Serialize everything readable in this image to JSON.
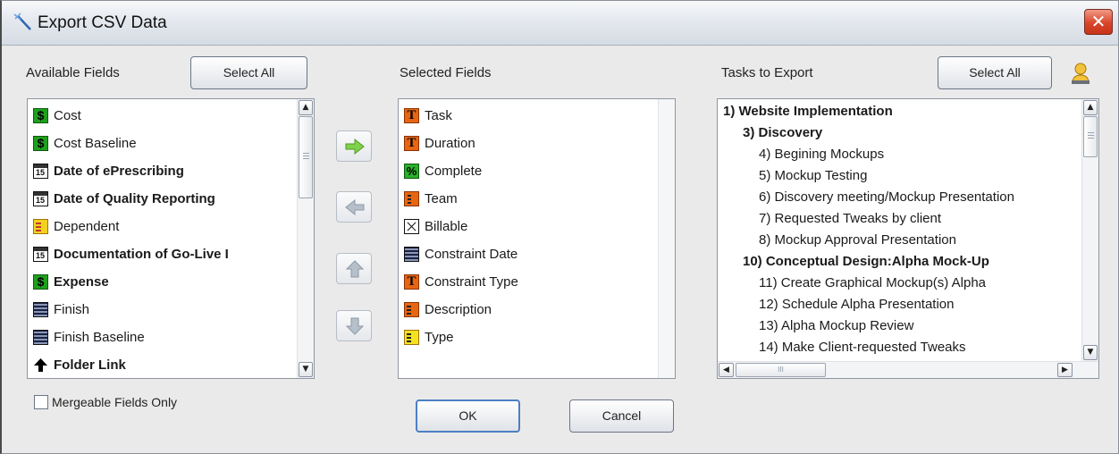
{
  "window": {
    "title": "Export CSV Data",
    "close_glyph": "✕",
    "app_icon": "wand-icon"
  },
  "available": {
    "label": "Available Fields",
    "select_all": "Select All",
    "items": [
      {
        "label": "Cost",
        "icon": "currency-icon",
        "bold": false
      },
      {
        "label": "Cost Baseline",
        "icon": "currency-icon",
        "bold": false
      },
      {
        "label": "Date of ePrescribing",
        "icon": "date-icon",
        "bold": true
      },
      {
        "label": "Date of Quality Reporting",
        "icon": "date-icon",
        "bold": true
      },
      {
        "label": "Dependent",
        "icon": "dependency-icon",
        "bold": false
      },
      {
        "label": "Documentation of Go-Live I",
        "icon": "date-icon",
        "bold": true
      },
      {
        "label": "Expense",
        "icon": "currency-icon",
        "bold": true
      },
      {
        "label": "Finish",
        "icon": "calendar-icon",
        "bold": false
      },
      {
        "label": "Finish Baseline",
        "icon": "calendar-icon",
        "bold": false
      },
      {
        "label": "Folder Link",
        "icon": "link-arrow-icon",
        "bold": true
      }
    ],
    "mergeable_label": "Mergeable Fields Only"
  },
  "selected": {
    "label": "Selected Fields",
    "items": [
      {
        "label": "Task",
        "icon": "text-icon"
      },
      {
        "label": "Duration",
        "icon": "text-icon"
      },
      {
        "label": "Complete",
        "icon": "percent-icon"
      },
      {
        "label": "Team",
        "icon": "team-icon"
      },
      {
        "label": "Billable",
        "icon": "checkbox-icon"
      },
      {
        "label": "Constraint Date",
        "icon": "calendar-icon"
      },
      {
        "label": "Constraint Type",
        "icon": "text-icon"
      },
      {
        "label": "Description",
        "icon": "description-icon"
      },
      {
        "label": "Type",
        "icon": "type-icon"
      }
    ]
  },
  "tasks": {
    "label": "Tasks to Export",
    "select_all": "Select All",
    "user_icon": "user-icon",
    "items": [
      {
        "label": "1) Website Implementation",
        "level": 0,
        "bold": true
      },
      {
        "label": "3) Discovery",
        "level": 1,
        "bold": true
      },
      {
        "label": "4) Begining Mockups",
        "level": 2,
        "bold": false
      },
      {
        "label": "5) Mockup Testing",
        "level": 2,
        "bold": false
      },
      {
        "label": "6) Discovery meeting/Mockup Presentation",
        "level": 2,
        "bold": false
      },
      {
        "label": "7) Requested Tweaks by client",
        "level": 2,
        "bold": false
      },
      {
        "label": "8) Mockup Approval Presentation",
        "level": 2,
        "bold": false
      },
      {
        "label": "10) Conceptual Design:Alpha Mock-Up",
        "level": 1,
        "bold": true
      },
      {
        "label": "11) Create Graphical Mockup(s) Alpha",
        "level": 2,
        "bold": false
      },
      {
        "label": "12) Schedule Alpha Presentation",
        "level": 2,
        "bold": false
      },
      {
        "label": "13) Alpha Mockup Review",
        "level": 2,
        "bold": false
      },
      {
        "label": "14) Make Client-requested Tweaks",
        "level": 2,
        "bold": false
      }
    ]
  },
  "move_buttons": [
    {
      "name": "add-field-button",
      "icon": "arrow-right-icon",
      "color": "#7fd24a"
    },
    {
      "name": "remove-field-button",
      "icon": "arrow-left-icon",
      "color": "#a9b4bf"
    },
    {
      "name": "move-up-button",
      "icon": "arrow-up-icon",
      "color": "#a9b4bf"
    },
    {
      "name": "move-down-button",
      "icon": "arrow-down-icon",
      "color": "#a9b4bf"
    }
  ],
  "footer": {
    "ok": "OK",
    "cancel": "Cancel"
  },
  "scroll_glyphs": {
    "up": "▲",
    "down": "▼",
    "left": "◀",
    "right": "▶",
    "thumb_grip": "III"
  }
}
